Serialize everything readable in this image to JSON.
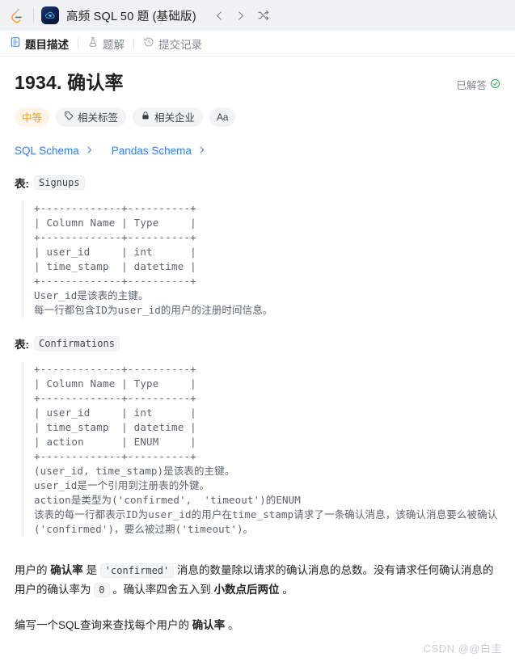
{
  "topbar": {
    "logo_icon": "leetcode-logo-icon",
    "app_icon": "sql-cloud-app-icon",
    "title": "高频 SQL 50 题 (基础版)",
    "prev_icon": "chevron-left-icon",
    "next_icon": "chevron-right-icon",
    "shuffle_icon": "shuffle-icon"
  },
  "tabs": [
    {
      "label": "题目描述",
      "icon": "document-icon",
      "active": true
    },
    {
      "label": "题解",
      "icon": "flask-icon",
      "active": false
    },
    {
      "label": "提交记录",
      "icon": "history-clock-icon",
      "active": false
    }
  ],
  "problem": {
    "title": "1934. 确认率",
    "solved_label": "已解答",
    "solved_icon": "check-circle-icon",
    "solved_color": "#22b14c"
  },
  "badges": [
    {
      "label": "中等",
      "icon": null,
      "kind": "difficulty",
      "color": "#f0a020"
    },
    {
      "label": "相关标签",
      "icon": "tag-icon",
      "kind": "normal"
    },
    {
      "label": "相关企业",
      "icon": "lock-icon",
      "kind": "normal"
    },
    {
      "label": "Aa",
      "icon": null,
      "kind": "font-size"
    }
  ],
  "schema_links": [
    {
      "label": "SQL Schema",
      "icon": "chevron-right-icon",
      "color": "#2b7fff"
    },
    {
      "label": "Pandas Schema",
      "icon": "chevron-right-icon",
      "color": "#2b7fff"
    }
  ],
  "tables": [
    {
      "label_prefix": "表:",
      "name": "Signups",
      "ascii": "+-------------+----------+\n| Column Name | Type     |\n+-------------+----------+\n| user_id     | int      |\n| time_stamp  | datetime |\n+-------------+----------+",
      "notes": "User_id是该表的主键。\n每一行都包含ID为user_id的用户的注册时间信息。"
    },
    {
      "label_prefix": "表:",
      "name": "Confirmations",
      "ascii": "+-------------+----------+\n| Column Name | Type     |\n+-------------+----------+\n| user_id     | int      |\n| time_stamp  | datetime |\n| action      | ENUM     |\n+-------------+----------+",
      "notes": "(user_id, time_stamp)是该表的主键。\nuser_id是一个引用到注册表的外键。\naction是类型为('confirmed',  'timeout')的ENUM\n该表的每一行都表示ID为user_id的用户在time_stamp请求了一条确认消息，该确认消息要么被确认('confirmed')，要么被过期('timeout')。"
    }
  ],
  "paragraphs": {
    "p1": {
      "s1": "用户的 ",
      "b1": "确认率",
      "s2": " 是 ",
      "code1": "'confirmed'",
      "s3": " 消息的数量除以请求的确认消息的总数。没有请求任何确认消息的用户的确认率为 ",
      "code2": "0",
      "s4": " 。确认率四舍五入到 ",
      "b2": "小数点后两位",
      "s5": " 。"
    },
    "p2": {
      "s1": "编写一个SQL查询来查找每个用户的 ",
      "b1": "确认率",
      "s2": " 。"
    }
  },
  "watermark": "CSDN @@白圭"
}
